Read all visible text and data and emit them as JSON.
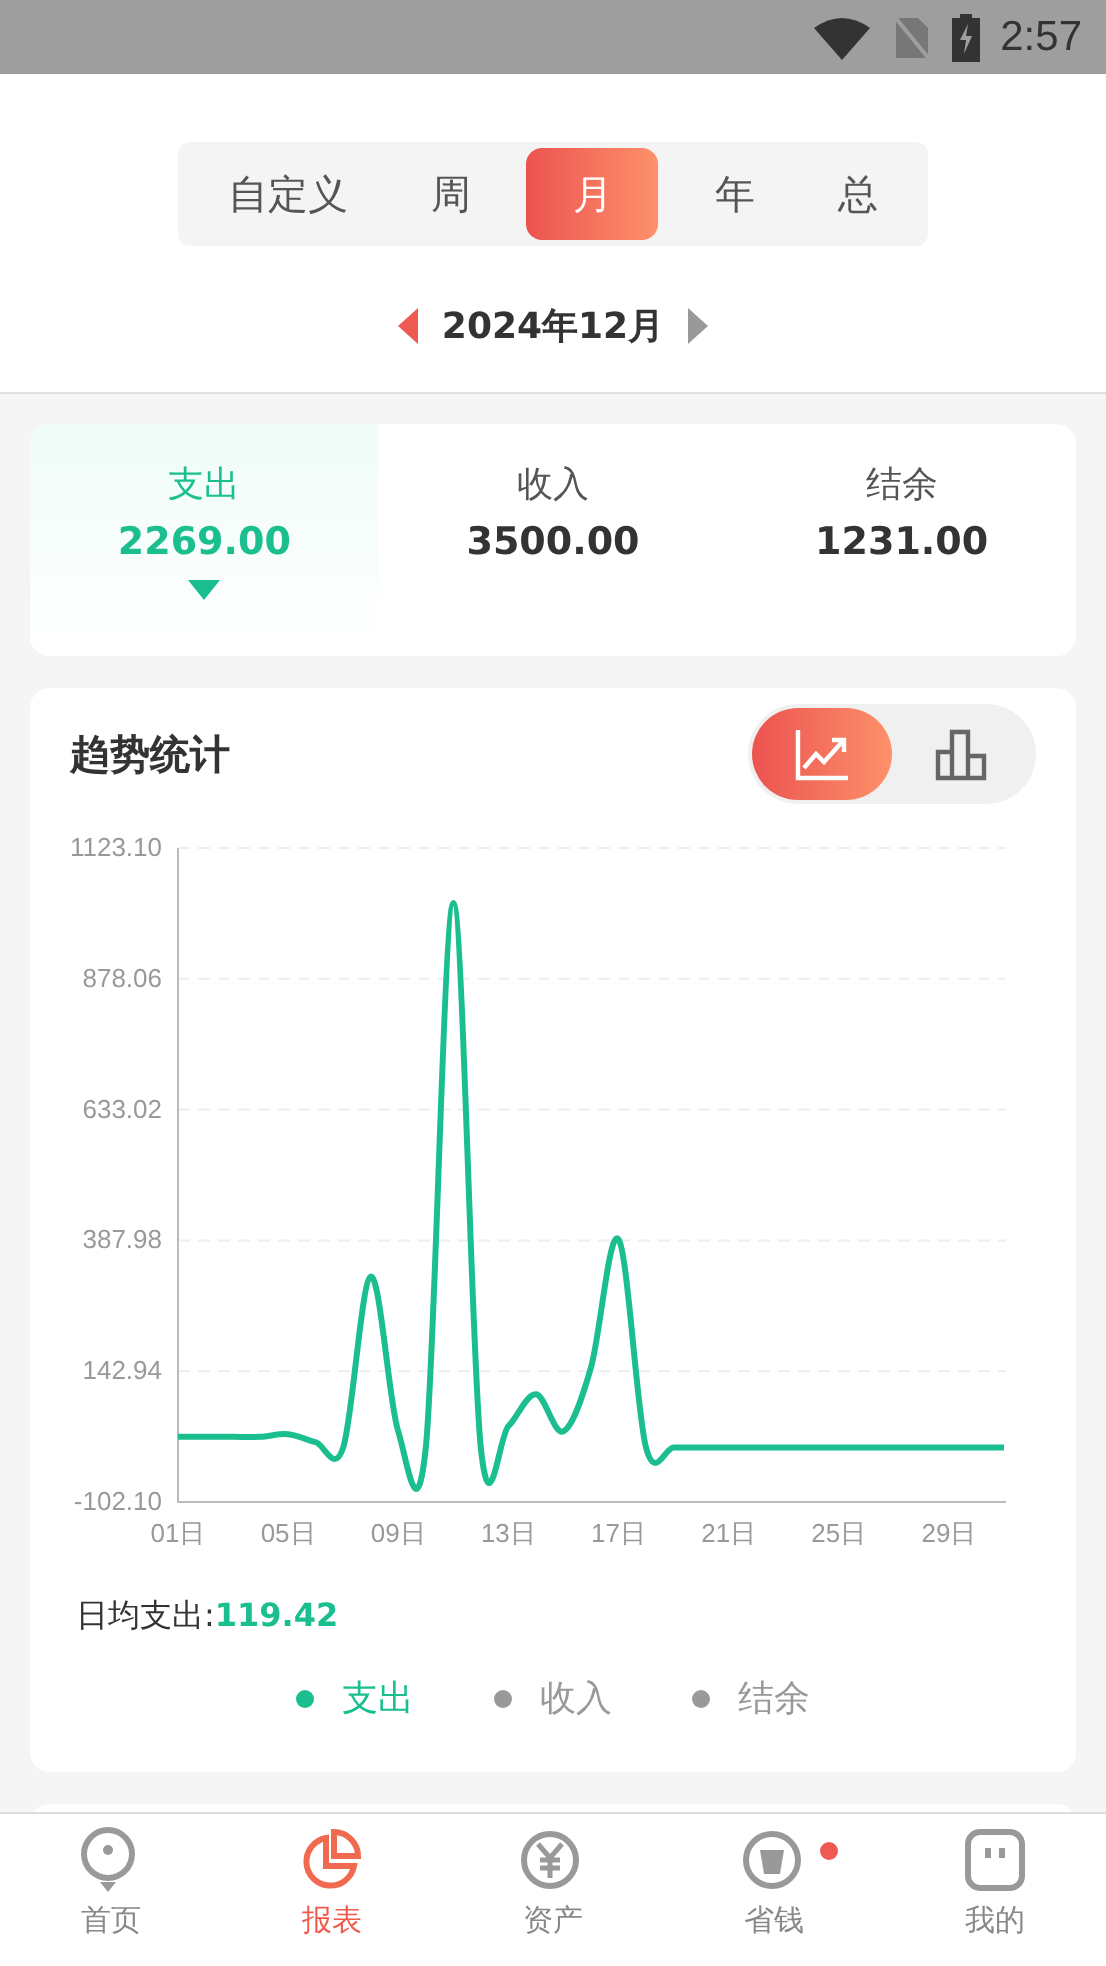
{
  "status_bar": {
    "time": "2:57"
  },
  "period_tabs": [
    {
      "label": "自定义",
      "selected": false
    },
    {
      "label": "周",
      "selected": false
    },
    {
      "label": "月",
      "selected": true
    },
    {
      "label": "年",
      "selected": false
    },
    {
      "label": "总",
      "selected": false
    }
  ],
  "date_nav": {
    "label": "2024年12月"
  },
  "summary": [
    {
      "label": "支出",
      "value": "2269.00",
      "selected": true
    },
    {
      "label": "收入",
      "value": "3500.00",
      "selected": false
    },
    {
      "label": "结余",
      "value": "1231.00",
      "selected": false
    }
  ],
  "trend": {
    "title": "趋势统计",
    "chart_types": [
      {
        "kind": "line",
        "selected": true
      },
      {
        "kind": "bar",
        "selected": false
      }
    ],
    "chart_data": {
      "type": "line",
      "x": [
        1,
        2,
        3,
        4,
        5,
        6,
        7,
        8,
        9,
        10,
        11,
        12,
        13,
        14,
        15,
        16,
        17,
        18,
        19,
        20,
        21,
        22,
        23,
        24,
        25,
        26,
        27,
        28,
        29,
        30,
        31
      ],
      "xlim": [
        1,
        31
      ],
      "grid": true,
      "series": [
        {
          "color": "#1bbf8f",
          "values": [
            20,
            20,
            20,
            20,
            25,
            10,
            0,
            320,
            30,
            0,
            1020,
            0,
            40,
            100,
            30,
            150,
            390,
            0,
            0,
            0,
            0,
            0,
            0,
            0,
            0,
            0,
            0,
            0,
            0,
            0,
            0
          ]
        }
      ],
      "ylim": [
        -102.1,
        1123.1
      ],
      "yticks": [
        {
          "value": -102.1,
          "label": "-102.10"
        },
        {
          "value": 142.94,
          "label": "142.94"
        },
        {
          "value": 387.98,
          "label": "387.98"
        },
        {
          "value": 633.02,
          "label": "633.02"
        },
        {
          "value": 878.06,
          "label": "878.06"
        },
        {
          "value": 1123.1,
          "label": "1123.10"
        }
      ],
      "xticks": [
        {
          "value": 1,
          "label": "01日"
        },
        {
          "value": 5,
          "label": "05日"
        },
        {
          "value": 9,
          "label": "09日"
        },
        {
          "value": 13,
          "label": "13日"
        },
        {
          "value": 17,
          "label": "17日"
        },
        {
          "value": 21,
          "label": "21日"
        },
        {
          "value": 25,
          "label": "25日"
        },
        {
          "value": 29,
          "label": "29日"
        }
      ]
    },
    "daily_average": {
      "label": "日均支出:",
      "value": "119.42"
    },
    "legend": [
      {
        "label": "支出",
        "selected": true
      },
      {
        "label": "收入",
        "selected": false
      },
      {
        "label": "结余",
        "selected": false
      }
    ]
  },
  "bottom_nav": [
    {
      "label": "首页",
      "kind": "home",
      "selected": false,
      "badge": false
    },
    {
      "label": "报表",
      "kind": "report",
      "selected": true,
      "badge": false
    },
    {
      "label": "资产",
      "kind": "asset",
      "selected": false,
      "badge": false
    },
    {
      "label": "省钱",
      "kind": "save",
      "selected": false,
      "badge": true
    },
    {
      "label": "我的",
      "kind": "me",
      "selected": false,
      "badge": false
    }
  ]
}
